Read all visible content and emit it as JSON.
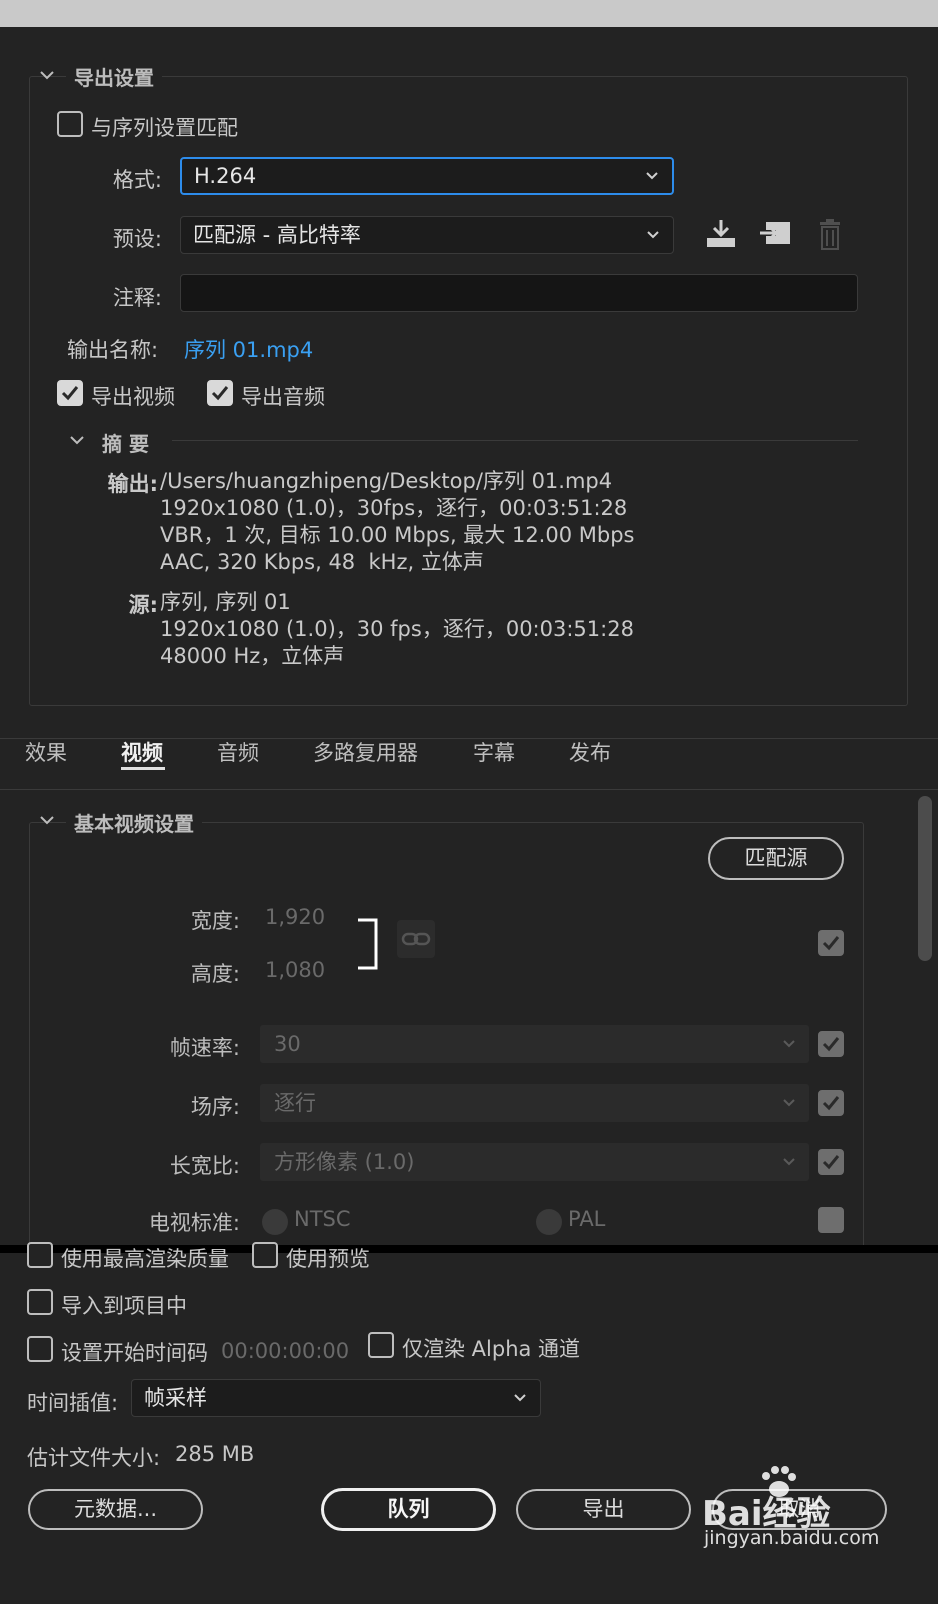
{
  "export_settings": {
    "title": "导出设置",
    "match_sequence_label": "与序列设置匹配",
    "match_sequence_checked": false,
    "format_label": "格式:",
    "format_value": "H.264",
    "preset_label": "预设:",
    "preset_value": "匹配源 - 高比特率",
    "comments_label": "注释:",
    "comments_value": "",
    "output_name_label": "输出名称:",
    "output_name_value": "序列 01.mp4",
    "export_video_label": "导出视频",
    "export_video_checked": true,
    "export_audio_label": "导出音频",
    "export_audio_checked": true,
    "icons": [
      "save-preset-icon",
      "import-preset-icon",
      "delete-preset-icon"
    ]
  },
  "summary": {
    "title": "摘 要",
    "output_key": "输出:",
    "output_lines": [
      "/Users/huangzhipeng/Desktop/序列 01.mp4",
      "1920x1080 (1.0)，30fps，逐行，00:03:51:28",
      "VBR，1 次, 目标 10.00 Mbps, 最大 12.00 Mbps",
      "AAC, 320 Kbps, 48  kHz, 立体声"
    ],
    "source_key": "源:",
    "source_lines": [
      "序列, 序列 01",
      "1920x1080 (1.0)，30 fps，逐行，00:03:51:28",
      "48000 Hz，立体声"
    ]
  },
  "tabs": [
    {
      "label": "效果",
      "active": false
    },
    {
      "label": "视频",
      "active": true
    },
    {
      "label": "音频",
      "active": false
    },
    {
      "label": "多路复用器",
      "active": false
    },
    {
      "label": "字幕",
      "active": false
    },
    {
      "label": "发布",
      "active": false
    }
  ],
  "video_settings": {
    "title": "基本视频设置",
    "match_source_button": "匹配源",
    "width_label": "宽度:",
    "width_value": "1,920",
    "height_label": "高度:",
    "height_value": "1,080",
    "frame_rate_label": "帧速率:",
    "frame_rate_value": "30",
    "field_order_label": "场序:",
    "field_order_value": "逐行",
    "aspect_label": "长宽比:",
    "aspect_value": "方形像素 (1.0)",
    "tv_standard_label": "电视标准:",
    "tv_ntsc": "NTSC",
    "tv_pal": "PAL"
  },
  "bottom": {
    "max_render_quality_label": "使用最高渲染质量",
    "max_render_quality_checked": false,
    "use_previews_label": "使用预览",
    "use_previews_checked": false,
    "import_into_project_label": "导入到项目中",
    "import_into_project_checked": false,
    "set_start_timecode_label": "设置开始时间码",
    "set_start_timecode_checked": false,
    "start_timecode_value": "00:00:00:00",
    "render_alpha_only_label": "仅渲染 Alpha 通道",
    "render_alpha_only_checked": false,
    "time_interpolation_label": "时间插值:",
    "time_interpolation_value": "帧采样",
    "estimated_size_label": "估计文件大小:",
    "estimated_size_value": "285 MB",
    "metadata_button": "元数据...",
    "queue_button": "队列",
    "export_button": "导出",
    "cancel_button": "取消"
  },
  "watermark": {
    "brand": "Bai经验",
    "url": "jingyan.baidu.com"
  },
  "colors": {
    "background": "#232323",
    "accent_blue": "#3aa0f2",
    "focus_border": "#2d8ceb"
  }
}
